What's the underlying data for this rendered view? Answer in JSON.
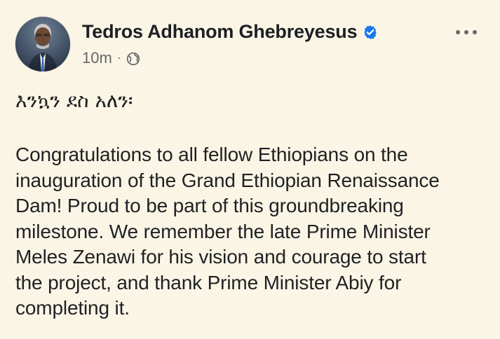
{
  "post": {
    "author": "Tedros Adhanom Ghebreyesus",
    "time": "10m",
    "separator": "·",
    "audience_icon": "globe-icon",
    "verified_icon": "verified-badge-icon",
    "more_icon": "more-options-icon",
    "amharic_line": "እንኳን ደስ አለን፡",
    "body": "Congratulations to all fellow Ethiopians on the\ninauguration of the Grand Ethiopian Renaissance\nDam! Proud to be part of this groundbreaking\nmilestone. We remember the late Prime Minister\nMeles Zenawi for his vision and courage to start\nthe project, and thank Prime Minister Abiy for\ncompleting it."
  },
  "colors": {
    "background": "#fbf5e6",
    "text": "#1f2124",
    "secondary": "#65676b",
    "verified": "#1877f2"
  }
}
